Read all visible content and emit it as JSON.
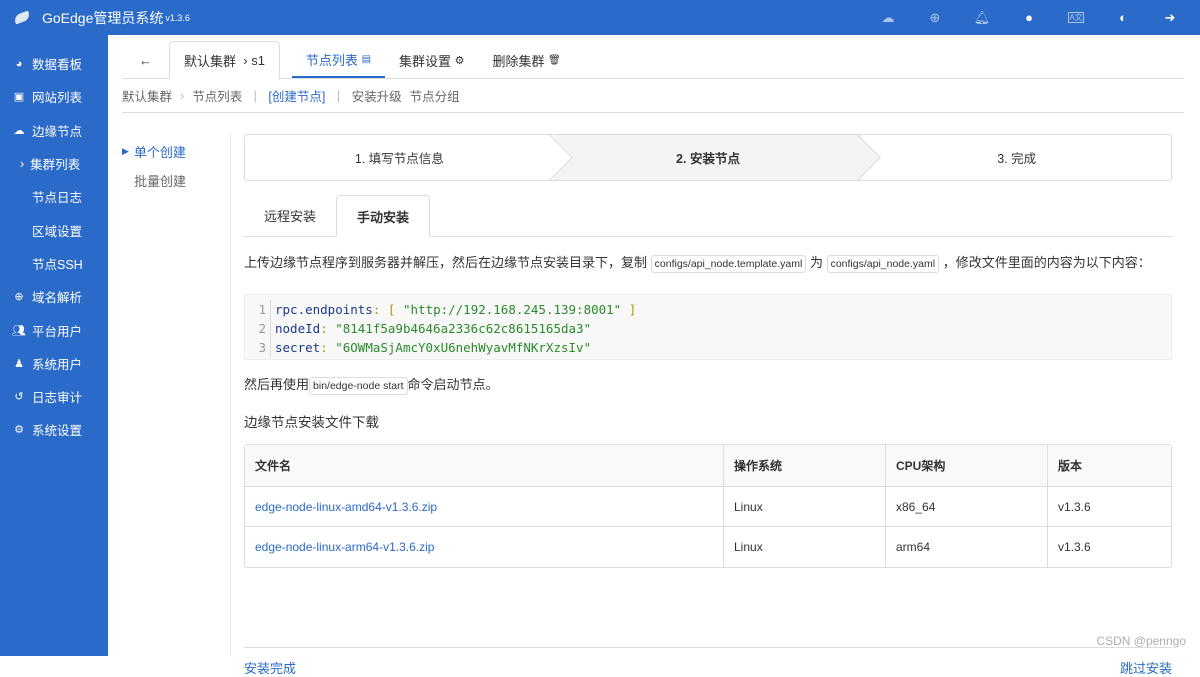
{
  "app": {
    "title": "GoEdge管理员系统",
    "version": "v1.3.6"
  },
  "topbar_icons": [
    "cloud-icon",
    "globe-icon",
    "bell-icon",
    "user-icon",
    "language-icon",
    "contrast-icon",
    "logout-icon"
  ],
  "sidebar": {
    "items": [
      {
        "label": "数据看板",
        "icon": "dashboard-icon"
      },
      {
        "label": "网站列表",
        "icon": "clone-icon"
      },
      {
        "label": "边缘节点",
        "icon": "cloud-icon"
      },
      {
        "label": "集群列表",
        "sub": true,
        "active": true
      },
      {
        "label": "节点日志",
        "sub": true
      },
      {
        "label": "区域设置",
        "sub": true
      },
      {
        "label": "节点SSH",
        "sub": true
      },
      {
        "label": "域名解析",
        "icon": "globe-icon"
      },
      {
        "label": "平台用户",
        "icon": "users-icon"
      },
      {
        "label": "系统用户",
        "icon": "user-secret-icon"
      },
      {
        "label": "日志审计",
        "icon": "history-icon"
      },
      {
        "label": "系统设置",
        "icon": "gear-icon"
      }
    ]
  },
  "tabs": {
    "crumb_cluster": "默认集群",
    "crumb_node": "s1",
    "node_list": "节点列表",
    "cluster_settings": "集群设置",
    "delete_cluster": "删除集群"
  },
  "subnav": {
    "cluster": "默认集群",
    "node_list": "节点列表",
    "create": "[创建节点]",
    "upgrade": "安装升级",
    "groups": "节点分组"
  },
  "left_menu": {
    "single": "单个创建",
    "batch": "批量创建"
  },
  "steps": [
    "1. 填写节点信息",
    "2. 安装节点",
    "3. 完成"
  ],
  "install_tabs": {
    "remote": "远程安装",
    "manual": "手动安装"
  },
  "desc": {
    "part1": "上传边缘节点程序到服务器并解压，然后在边缘节点安装目录下，复制",
    "file1": "configs/api_node.template.yaml",
    "part2": "为",
    "file2": "configs/api_node.yaml",
    "part3": "，修改文件里面的内容为以下内容："
  },
  "code": [
    {
      "n": "1",
      "key": "rpc.endpoints",
      "open": "[",
      "val": "\"http://192.168.245.139:8001\"",
      "close": "]"
    },
    {
      "n": "2",
      "key": "nodeId",
      "val": "\"8141f5a9b4646a2336c62c8615165da3\""
    },
    {
      "n": "3",
      "key": "secret",
      "val": "\"6OWMaSjAmcY0xU6nehWyavMfNKrXzsIv\""
    }
  ],
  "then": {
    "part1": "然后再使用",
    "cmd": "bin/edge-node start",
    "part2": "命令启动节点。"
  },
  "download_title": "边缘节点安装文件下载",
  "table": {
    "headers": [
      "文件名",
      "操作系统",
      "CPU架构",
      "版本"
    ],
    "rows": [
      [
        "edge-node-linux-amd64-v1.3.6.zip",
        "Linux",
        "x86_64",
        "v1.3.6"
      ],
      [
        "edge-node-linux-arm64-v1.3.6.zip",
        "Linux",
        "arm64",
        "v1.3.6"
      ]
    ]
  },
  "footer": {
    "done": "安装完成",
    "skip": "跳过安装"
  },
  "watermark": "CSDN @penngo"
}
